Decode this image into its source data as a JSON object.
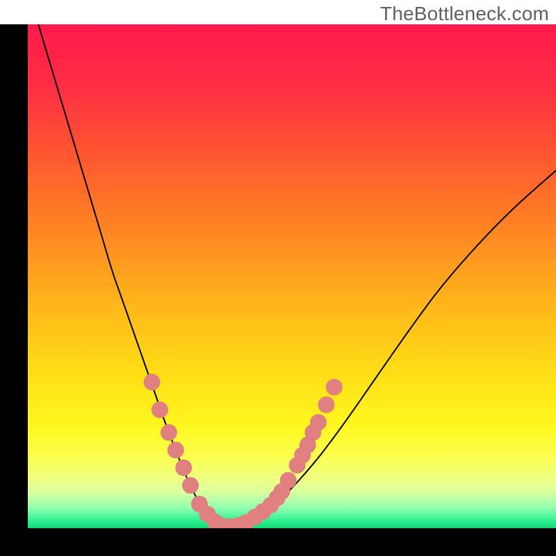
{
  "watermark": "TheBottleneck.com",
  "gradient": {
    "stops": [
      {
        "offset": 0.0,
        "color": "#ff1a4a"
      },
      {
        "offset": 0.12,
        "color": "#ff2d44"
      },
      {
        "offset": 0.25,
        "color": "#ff5430"
      },
      {
        "offset": 0.4,
        "color": "#ff8224"
      },
      {
        "offset": 0.55,
        "color": "#ffb41a"
      },
      {
        "offset": 0.7,
        "color": "#ffe015"
      },
      {
        "offset": 0.8,
        "color": "#fff820"
      },
      {
        "offset": 0.86,
        "color": "#fbff50"
      },
      {
        "offset": 0.9,
        "color": "#f0ff80"
      },
      {
        "offset": 0.93,
        "color": "#d8ffa0"
      },
      {
        "offset": 0.96,
        "color": "#90ffb0"
      },
      {
        "offset": 0.985,
        "color": "#30f090"
      },
      {
        "offset": 1.0,
        "color": "#10d878"
      }
    ]
  },
  "chart_data": {
    "type": "line",
    "title": "",
    "xlabel": "",
    "ylabel": "",
    "xlim": [
      0,
      100
    ],
    "ylim": [
      0,
      100
    ],
    "series": [
      {
        "name": "bottleneck-curve",
        "x": [
          2,
          4,
          6,
          8,
          10,
          12,
          14,
          16,
          18,
          20,
          22,
          24,
          26,
          28,
          29.5,
          31,
          32.5,
          34,
          35.5,
          37,
          39,
          42,
          46,
          50,
          55,
          60,
          66,
          72,
          78,
          85,
          92,
          100
        ],
        "y": [
          100,
          93,
          86,
          79,
          72,
          65,
          58,
          51,
          45,
          39,
          33,
          27,
          21,
          15.5,
          11.5,
          8,
          5,
          2.8,
          1.3,
          0.3,
          0.3,
          1.5,
          4,
          8,
          14,
          21,
          30,
          39,
          47.5,
          56,
          63.5,
          71
        ]
      }
    ],
    "markers": {
      "name": "sample-markers",
      "color": "#e08080",
      "radius": 12,
      "points": [
        {
          "x": 23.5,
          "y": 29
        },
        {
          "x": 25.0,
          "y": 23.5
        },
        {
          "x": 26.7,
          "y": 19
        },
        {
          "x": 28.0,
          "y": 15.5
        },
        {
          "x": 29.5,
          "y": 12
        },
        {
          "x": 30.8,
          "y": 8.5
        },
        {
          "x": 32.5,
          "y": 4.8
        },
        {
          "x": 34.0,
          "y": 2.8
        },
        {
          "x": 35.5,
          "y": 1.2
        },
        {
          "x": 37.0,
          "y": 0.4
        },
        {
          "x": 38.5,
          "y": 0.3
        },
        {
          "x": 40.0,
          "y": 0.6
        },
        {
          "x": 41.3,
          "y": 1.1
        },
        {
          "x": 43.0,
          "y": 2.2
        },
        {
          "x": 44.5,
          "y": 3.3
        },
        {
          "x": 46.0,
          "y": 4.6
        },
        {
          "x": 47.2,
          "y": 6.0
        },
        {
          "x": 48.1,
          "y": 7.3
        },
        {
          "x": 49.3,
          "y": 9.5
        },
        {
          "x": 51.0,
          "y": 12.5
        },
        {
          "x": 52.0,
          "y": 14.5
        },
        {
          "x": 53.0,
          "y": 16.5
        },
        {
          "x": 54.0,
          "y": 19.0
        },
        {
          "x": 55.0,
          "y": 21.0
        },
        {
          "x": 56.5,
          "y": 24.5
        },
        {
          "x": 58.0,
          "y": 28.0
        }
      ]
    }
  }
}
